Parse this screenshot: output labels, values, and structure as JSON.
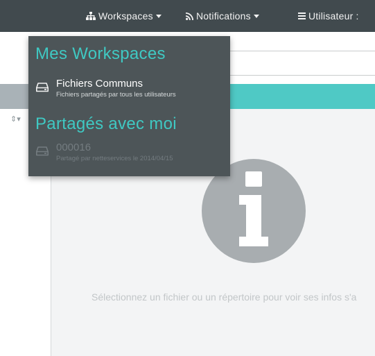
{
  "navbar": {
    "workspaces_label": "Workspaces",
    "notifications_label": "Notifications",
    "user_label": "Utilisateur :"
  },
  "dropdown": {
    "my_workspaces_heading": "Mes Workspaces",
    "my_workspaces": [
      {
        "title": "Fichiers Communs",
        "subtitle": "Fichiers partagés par tous les utilisateurs",
        "icon": "hdd-icon"
      }
    ],
    "shared_heading": "Partagés avec moi",
    "shared": [
      {
        "title": "000016",
        "subtitle": "Partagé par netteservices le 2014/04/15",
        "icon": "hdd-icon"
      }
    ]
  },
  "info_panel": {
    "message": "Sélectionnez un fichier ou un répertoire pour voir ses infos s'a",
    "icon": "info-icon"
  },
  "list": {
    "sort_icon": "sort-icon"
  },
  "colors": {
    "navbar": "#414a4e",
    "dropdown": "#4d5558",
    "accent_teal": "#3fc9c3",
    "teal_bar": "#4fc9c5",
    "grey_bar": "#a9b2b7",
    "info_bg": "#f3f4f5",
    "info_icon": "#a8adb0"
  }
}
